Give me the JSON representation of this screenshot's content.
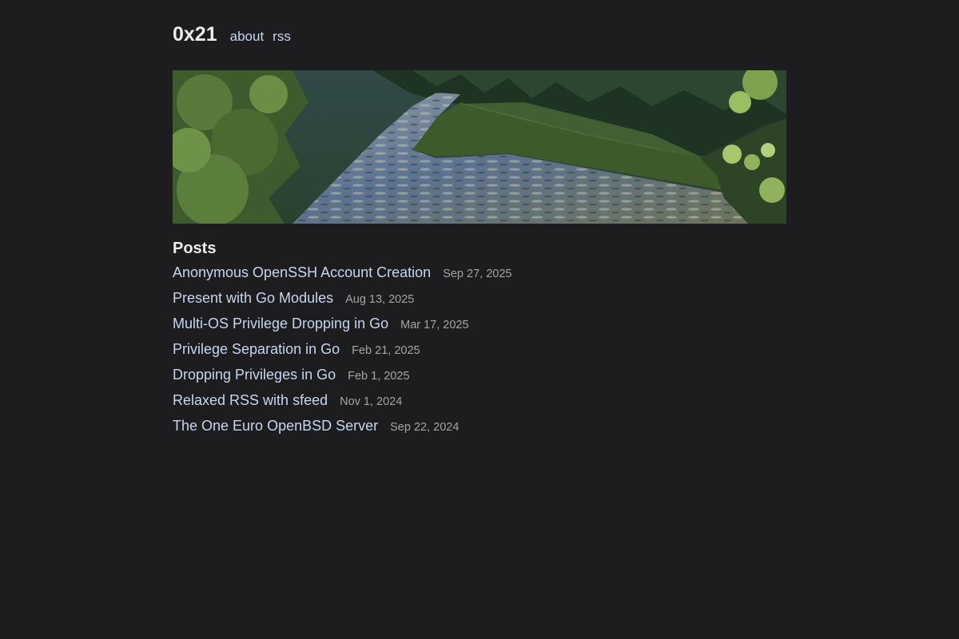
{
  "header": {
    "title": "0x21",
    "nav": [
      {
        "label": "about"
      },
      {
        "label": "rss"
      }
    ]
  },
  "posts": {
    "heading": "Posts",
    "items": [
      {
        "title": "Anonymous OpenSSH Account Creation",
        "date": "Sep 27, 2025"
      },
      {
        "title": "Present with Go Modules",
        "date": "Aug 13, 2025"
      },
      {
        "title": "Multi-OS Privilege Dropping in Go",
        "date": "Mar 17, 2025"
      },
      {
        "title": "Privilege Separation in Go",
        "date": "Feb 21, 2025"
      },
      {
        "title": "Dropping Privileges in Go",
        "date": "Feb 1, 2025"
      },
      {
        "title": "Relaxed RSS with sfeed",
        "date": "Nov 1, 2024"
      },
      {
        "title": "The One Euro OpenBSD Server",
        "date": "Sep 22, 2024"
      }
    ]
  },
  "colors": {
    "background": "#1d1d1f",
    "link": "#c5d6ee",
    "heading": "#ececec",
    "date": "#a5a5a8"
  }
}
